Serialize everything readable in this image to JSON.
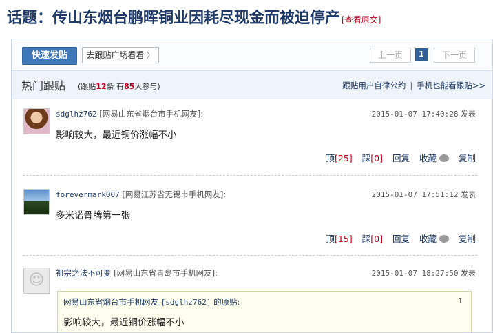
{
  "topic": {
    "prefix": "话题：",
    "title": "传山东烟台鹏晖铜业因耗尽现金而被迫停产",
    "link_open": "[",
    "link_label": "查看原文",
    "link_close": "]"
  },
  "toolbar": {
    "post_label": "快速发贴",
    "square_label": "去跟贴广场看看",
    "square_chevron": "〉",
    "prev_label": "上一页",
    "current_page": "1",
    "next_label": "下一页"
  },
  "hot": {
    "title": "热门跟贴",
    "stats_a": "(跟贴",
    "reply_count": "12",
    "stats_b": "条 有",
    "participant_count": "85",
    "stats_c": "人参与)",
    "rules_link": "跟贴用户自律公约",
    "separator": "|",
    "mobile_link": "手机也能看跟贴>>"
  },
  "posts": [
    {
      "username": "sdglhz762",
      "location": "[网易山东省烟台市手机网友]:",
      "timestamp": "2015-01-07 17:40:28",
      "posted_label": "发表",
      "content": "影响较大，最近铜价涨幅不小",
      "up_label": "顶",
      "up_count": "[25]",
      "down_label": "踩",
      "down_count": "[0]",
      "reply_label": "回复",
      "fav_label": "收藏",
      "copy_label": "复制"
    },
    {
      "username": "forevermark007",
      "location": "[网易江苏省无锡市手机网友]:",
      "timestamp": "2015-01-07 17:51:12",
      "posted_label": "发表",
      "content": "多米诺骨牌第一张",
      "up_label": "顶",
      "up_count": "[15]",
      "down_label": "踩",
      "down_count": "[0]",
      "reply_label": "回复",
      "fav_label": "收藏",
      "copy_label": "复制"
    },
    {
      "username": "祖宗之法不可变",
      "location": "[网易山东省青岛市手机网友]:",
      "timestamp": "2015-01-07 18:27:50",
      "posted_label": "发表"
    }
  ],
  "quote": {
    "prefix": "网易山东省烟台市手机网友",
    "user": "[sdglhz762]",
    "suffix": "的原贴:",
    "floor": "1",
    "content": "影响较大，最近铜价涨幅不小"
  },
  "colors": {
    "title": "#1f3a66",
    "accent_red": "#c3001c",
    "button_blue": "#3f78b8",
    "header_bg": "#eef4fa"
  }
}
